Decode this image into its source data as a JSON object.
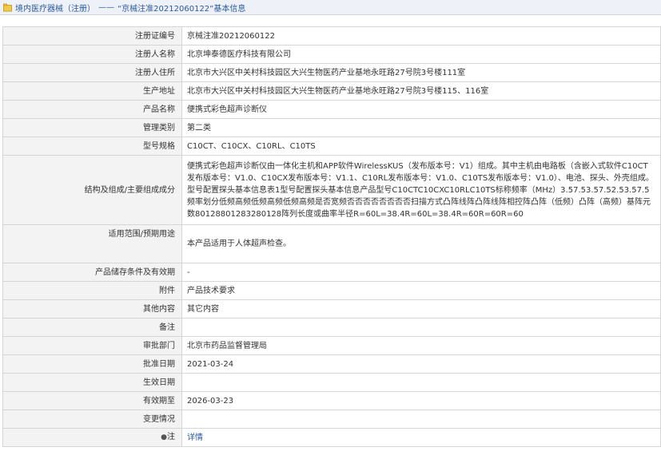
{
  "breadcrumb": {
    "section": "境内医疗器械（注册）",
    "separator": "——",
    "title": "“京械注准20212060122”基本信息"
  },
  "rows": [
    {
      "label": "注册证编号",
      "value": "京械注准20212060122"
    },
    {
      "label": "注册人名称",
      "value": "北京坤泰德医疗科技有限公司"
    },
    {
      "label": "注册人住所",
      "value": "北京市大兴区中关村科技园区大兴生物医药产业基地永旺路27号院3号楼111室"
    },
    {
      "label": "生产地址",
      "value": "北京市大兴区中关村科技园区大兴生物医药产业基地永旺路27号院3号楼115、116室"
    },
    {
      "label": "产品名称",
      "value": "便携式彩色超声诊断仪"
    },
    {
      "label": "管理类别",
      "value": "第二类"
    },
    {
      "label": "型号规格",
      "value": "C10CT、C10CX、C10RL、C10TS"
    },
    {
      "label": "结构及组成/主要组成成分",
      "value": "便携式彩色超声诊断仪由一体化主机和APP软件WirelessKUS（发布版本号：V1）组成。其中主机由电路板（含嵌入式软件C10CT发布版本号：V1.0、C10CX发布版本号：V1.1、C10RL发布版本号：V1.0、C10TS发布版本号：V1.0）、电池、探头、外壳组成。型号配置探头基本信息表1型号配置探头基本信息产品型号C10CTC10CXC10RLC10TS标称频率（MHz）3.57.53.57.52.53.57.5频率划分低频高频低频高频低频高频是否宽频否否否否否否否否扫描方式凸阵线阵凸阵线阵相控阵凸阵（低频）凸阵（高频）基阵元数80128801283280128阵列长度或曲率半径R=60L=38.4R=60L=38.4R=60R=60R=60"
    },
    {
      "label": "适用范围/预期用途",
      "value": "本产品适用于人体超声检查。"
    },
    {
      "label": "产品储存条件及有效期",
      "value": "-"
    },
    {
      "label": "附件",
      "value": "产品技术要求"
    },
    {
      "label": "其他内容",
      "value": "其它内容"
    },
    {
      "label": "备注",
      "value": ""
    },
    {
      "label": "审批部门",
      "value": "北京市药品监督管理局"
    },
    {
      "label": "批准日期",
      "value": "2021-03-24"
    },
    {
      "label": "生效日期",
      "value": ""
    },
    {
      "label": "有效期至",
      "value": "2026-03-23"
    },
    {
      "label": "变更情况",
      "value": ""
    },
    {
      "label": "注",
      "value": "详情"
    }
  ],
  "colors": {
    "link": "#2a5a9c",
    "label_bg": "#f3f3f3",
    "header_bg": "#eef2f8",
    "border": "#d6d6d6"
  }
}
